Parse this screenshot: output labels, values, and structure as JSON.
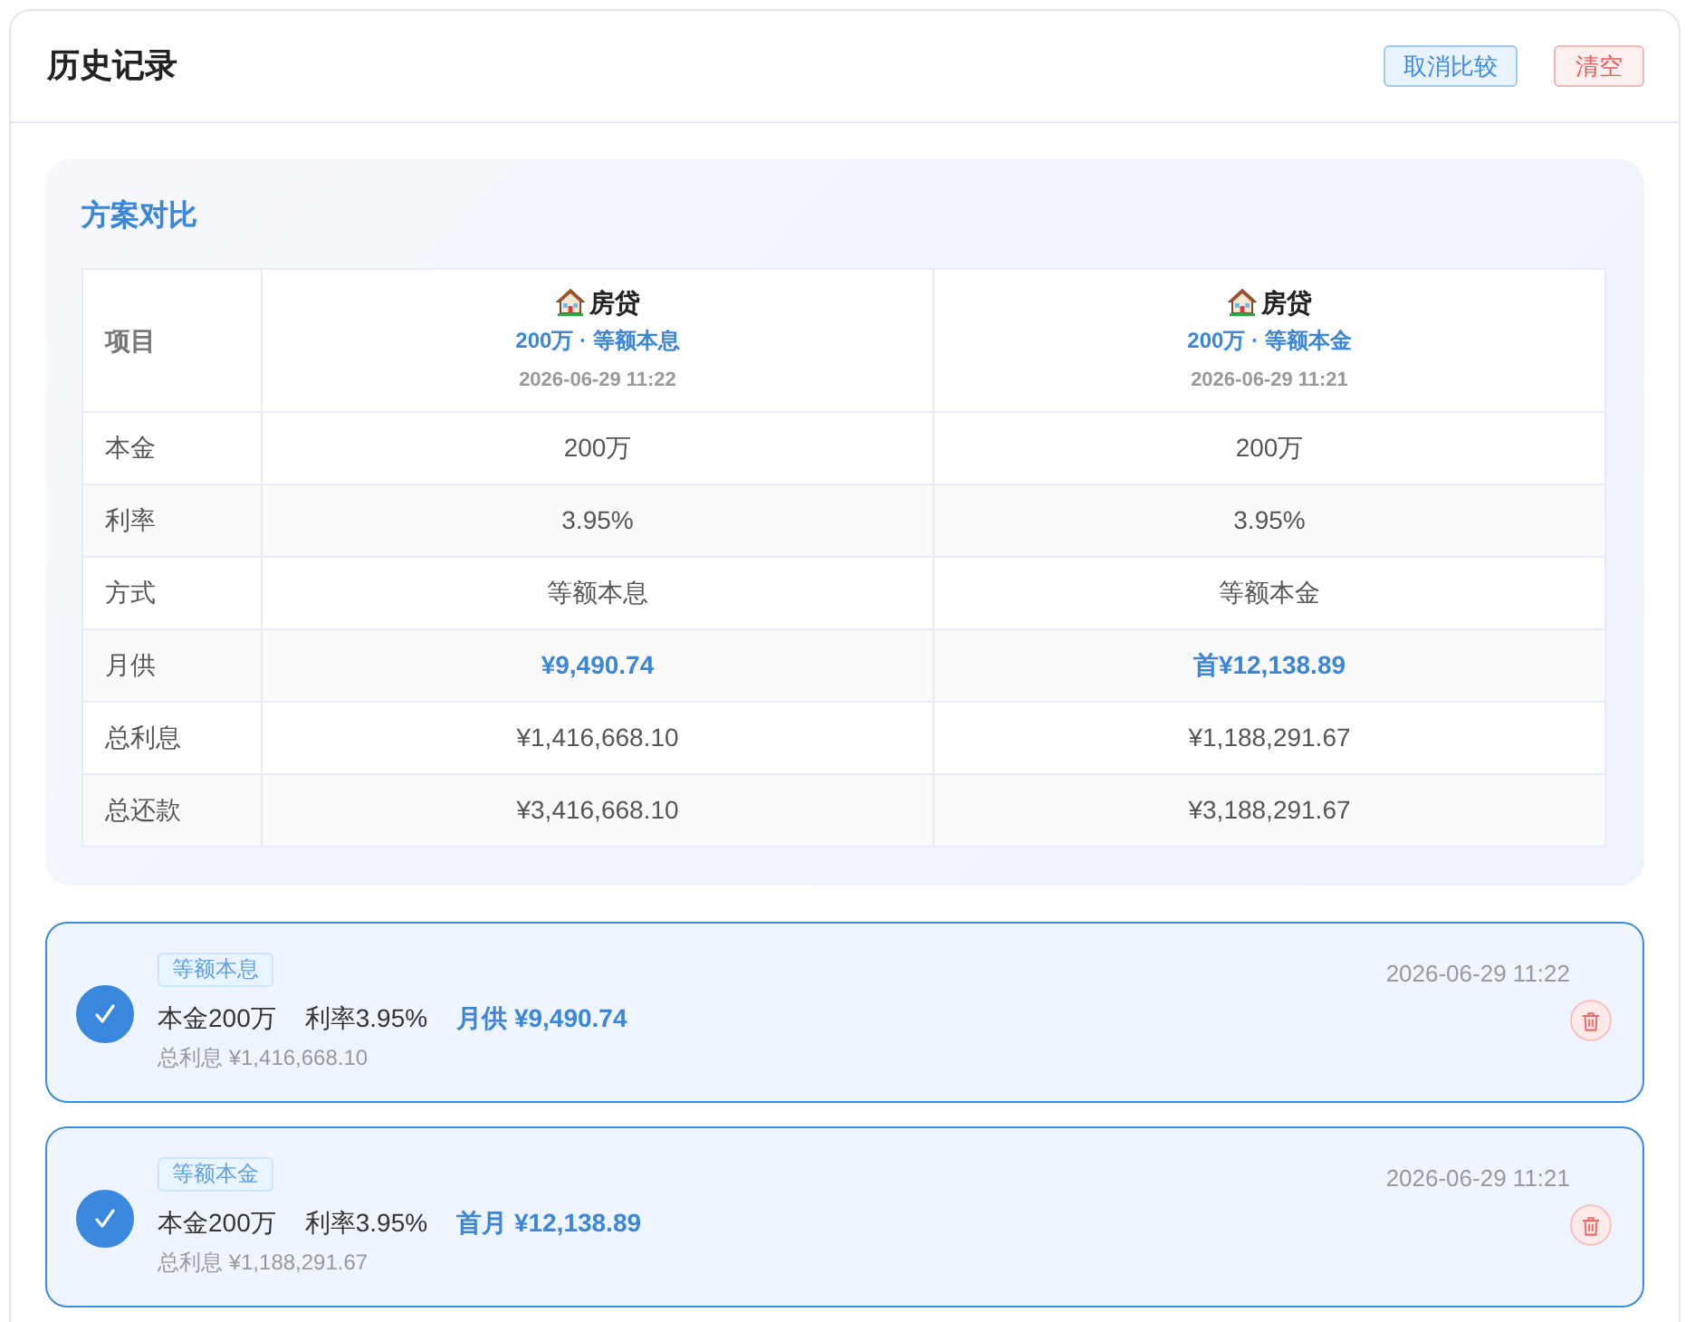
{
  "header": {
    "title": "历史记录",
    "buttons": [
      {
        "label": "取消比较",
        "kind": "primary"
      },
      {
        "label": "清空",
        "kind": "danger"
      }
    ]
  },
  "comparison": {
    "title": "方案对比",
    "corner_label": "项目",
    "plans": [
      {
        "name": "房贷",
        "summary": "200万 · 等额本息",
        "time": "2026-06-29 11:22"
      },
      {
        "name": "房贷",
        "summary": "200万 · 等额本金",
        "time": "2026-06-29 11:21"
      }
    ],
    "rows": [
      {
        "label": "本金",
        "values": [
          "200万",
          "200万"
        ],
        "highlight": false
      },
      {
        "label": "利率",
        "values": [
          "3.95%",
          "3.95%"
        ],
        "highlight": false
      },
      {
        "label": "方式",
        "values": [
          "等额本息",
          "等额本金"
        ],
        "highlight": false
      },
      {
        "label": "月供",
        "values": [
          "¥9,490.74",
          "首¥12,138.89"
        ],
        "highlight": true
      },
      {
        "label": "总利息",
        "values": [
          "¥1,416,668.10",
          "¥1,188,291.67"
        ],
        "highlight": false
      },
      {
        "label": "总还款",
        "values": [
          "¥3,416,668.10",
          "¥3,188,291.67"
        ],
        "highlight": false
      }
    ]
  },
  "history": [
    {
      "tag": "等额本息",
      "principal": "本金200万",
      "rate": "利率3.95%",
      "payment": "月供 ¥9,490.74",
      "interest": "总利息 ¥1,416,668.10",
      "time": "2026-06-29 11:22",
      "selected": true
    },
    {
      "tag": "等额本金",
      "principal": "本金200万",
      "rate": "利率3.95%",
      "payment": "首月 ¥12,138.89",
      "interest": "总利息 ¥1,188,291.67",
      "time": "2026-06-29 11:21",
      "selected": true
    }
  ]
}
